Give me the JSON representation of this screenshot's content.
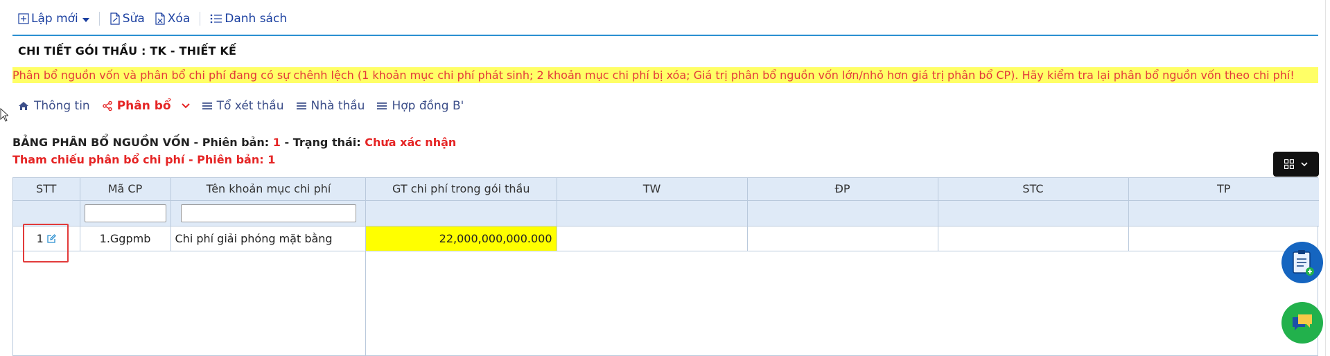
{
  "toolbar": {
    "new_label": "Lập mới",
    "edit_label": "Sửa",
    "delete_label": "Xóa",
    "list_label": "Danh sách"
  },
  "page": {
    "title": "CHI TIẾT GÓI THẦU : TK - THIẾT KẾ",
    "warning": "Phân bổ nguồn vốn và phân bổ chi phí đang có sự chênh lệch (1 khoản mục chi phí phát sinh; 2 khoản mục chi phí bị xóa; Giá trị phân bổ nguồn vốn lớn/nhỏ hơn giá trị phân bổ CP). Hãy kiểm tra lại phân bổ nguồn vốn theo chi phí!"
  },
  "tabs": [
    {
      "label": "Thông tin"
    },
    {
      "label": "Phân bổ"
    },
    {
      "label": "Tổ xét thầu"
    },
    {
      "label": "Nhà thầu"
    },
    {
      "label": "Hợp đồng B'"
    }
  ],
  "section": {
    "title_prefix": "BẢNG PHÂN BỔ NGUỒN VỐN - Phiên bản: ",
    "version": "1",
    "status_prefix": " - Trạng thái: ",
    "status": "Chưa xác nhận",
    "reference": "Tham chiếu phân bổ chi phí - Phiên bản: 1"
  },
  "table": {
    "headers": [
      "STT",
      "Mã CP",
      "Tên khoản mục chi phí",
      "GT chi phí trong gói thầu",
      "TW",
      "ĐP",
      "STC",
      "TP"
    ],
    "rows": [
      {
        "stt": "1",
        "ma_cp": "1.Ggpmb",
        "ten": "Chi phí giải phóng mặt bằng",
        "gt": "22,000,000,000.000",
        "tw": "",
        "dp": "",
        "stc": "",
        "tp": ""
      }
    ]
  },
  "colors": {
    "accent": "#1a3fa0",
    "warning_bg": "#ffff66",
    "warning_text": "#e33a3a",
    "active_tab": "#e52525"
  }
}
